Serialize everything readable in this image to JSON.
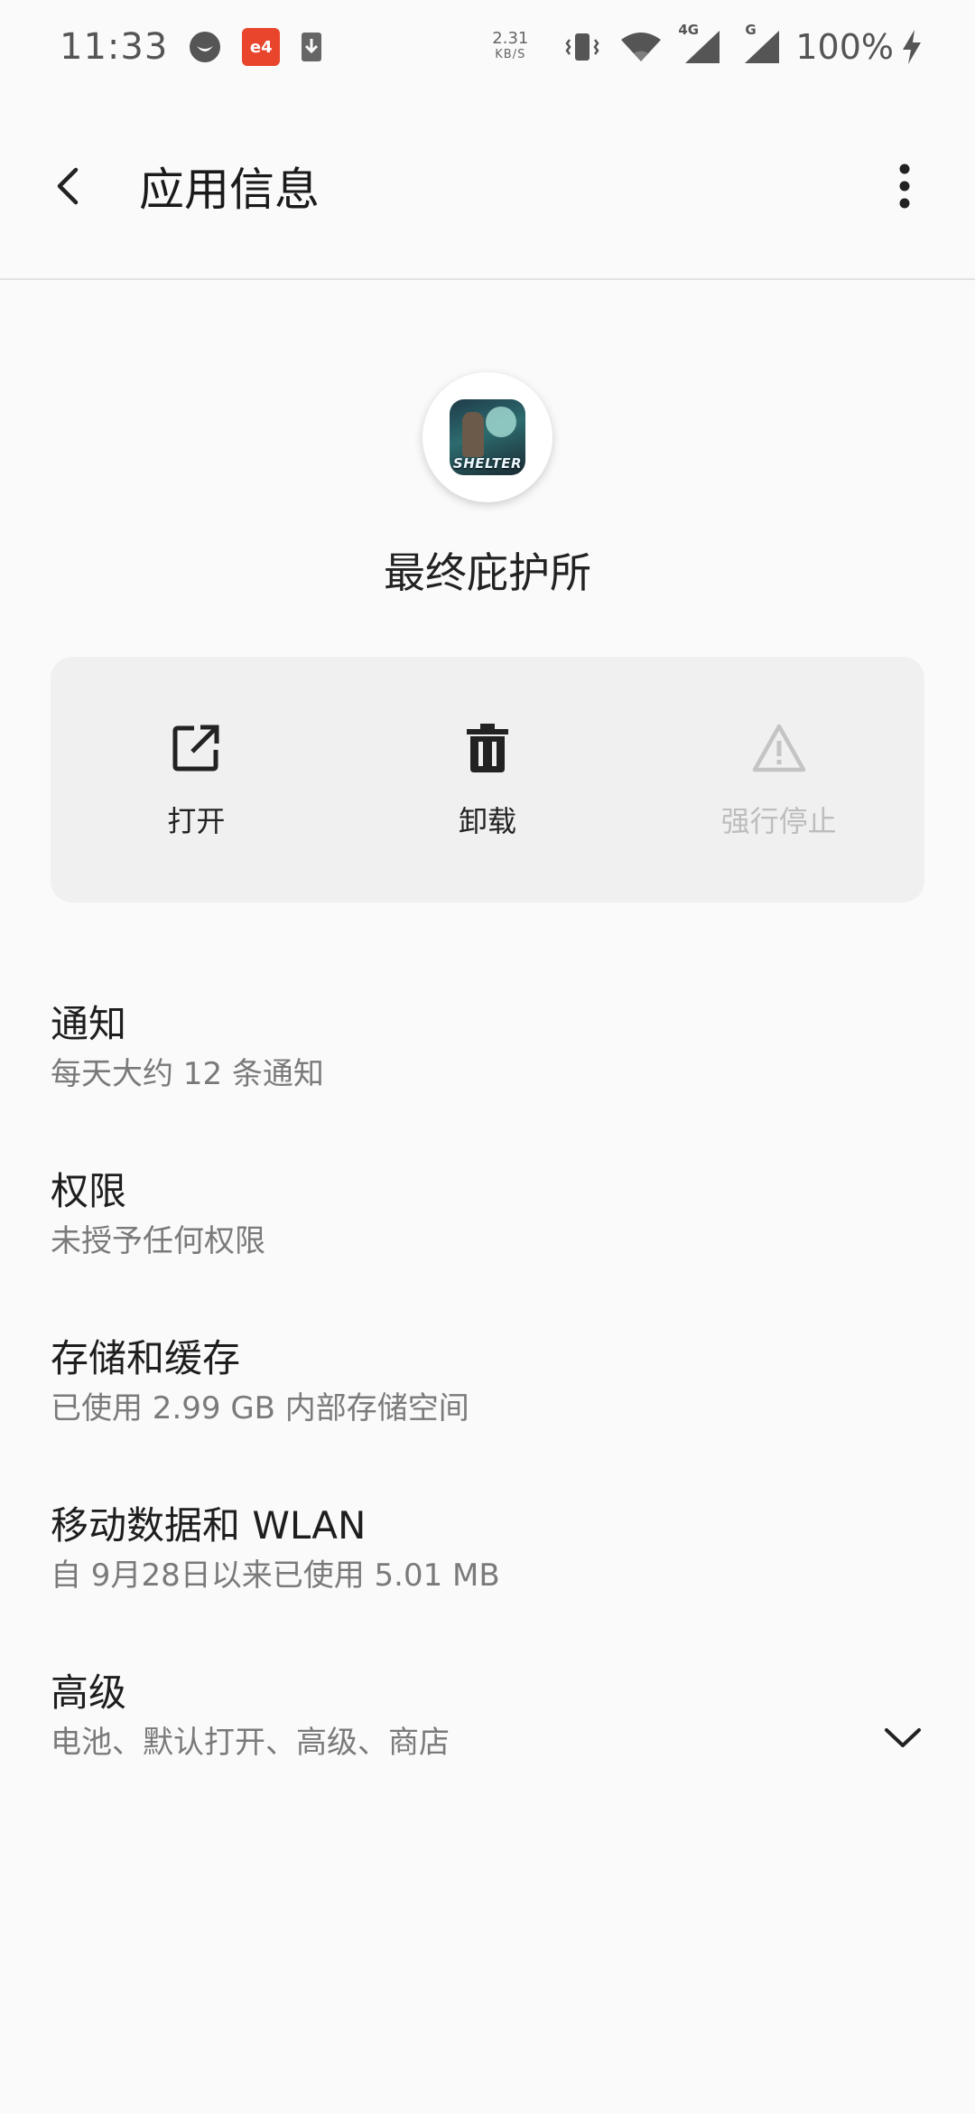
{
  "status_bar": {
    "time": "11:33",
    "net_speed_value": "2.31",
    "net_speed_unit": "KB/S",
    "network_label_1": "4G",
    "network_label_2": "G",
    "battery": "100%",
    "app_badge": "e4"
  },
  "toolbar": {
    "title": "应用信息"
  },
  "app": {
    "name": "最终庇护所",
    "icon_text": "SHELTER"
  },
  "actions": {
    "open_label": "打开",
    "uninstall_label": "卸载",
    "force_stop_label": "强行停止"
  },
  "settings": [
    {
      "title": "通知",
      "summary": "每天大约 12 条通知"
    },
    {
      "title": "权限",
      "summary": "未授予任何权限"
    },
    {
      "title": "存储和缓存",
      "summary": "已使用 2.99 GB 内部存储空间"
    },
    {
      "title": "移动数据和 WLAN",
      "summary": "自 9月28日以来已使用 5.01 MB"
    },
    {
      "title": "高级",
      "summary": "电池、默认打开、高级、商店"
    }
  ],
  "colors": {
    "background": "#fafafa",
    "card": "#f0f0f0",
    "disabled": "#bdbdbd",
    "summary": "#7a7a7a"
  }
}
